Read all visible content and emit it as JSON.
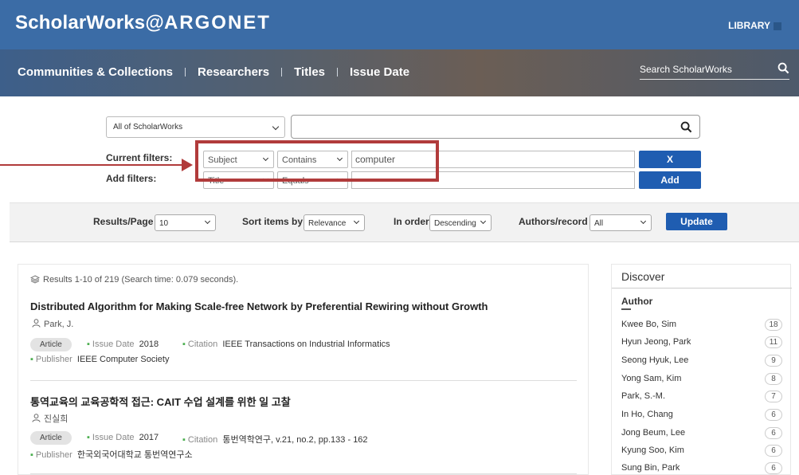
{
  "header": {
    "logo_main": "ScholarWorks@",
    "logo_argo": "ARGONET",
    "library_label": "LIBRARY",
    "nav": [
      "Communities & Collections",
      "Researchers",
      "Titles",
      "Issue Date"
    ],
    "search_placeholder": "Search ScholarWorks"
  },
  "search": {
    "scope_value": "All of ScholarWorks",
    "query_value": "",
    "current_filters_label": "Current filters:",
    "add_filters_label": "Add filters:",
    "current_filter": {
      "field": "Subject",
      "operator": "Contains",
      "value": "computer",
      "remove_label": "X"
    },
    "add_filter": {
      "field": "Title",
      "operator": "Equals",
      "value": "",
      "add_label": "Add"
    }
  },
  "options": {
    "results_per_page_label": "Results/Page",
    "results_per_page_value": "10",
    "sort_label": "Sort items by",
    "sort_value": "Relevance",
    "order_label": "In order",
    "order_value": "Descending",
    "authors_label": "Authors/record",
    "authors_value": "All",
    "update_label": "Update"
  },
  "results": {
    "info": "Results 1-10 of 219 (Search time: 0.079 seconds).",
    "items": [
      {
        "title": "Distributed Algorithm for Making Scale-free Network by Preferential Rewiring without Growth",
        "author": "Park, J.",
        "type": "Article",
        "issue_date_label": "Issue Date",
        "issue_date": "2018",
        "citation_label": "Citation",
        "citation": "IEEE Transactions on Industrial Informatics",
        "publisher_label": "Publisher",
        "publisher": "IEEE Computer Society"
      },
      {
        "title": "통역교육의 교육공학적 접근: CAIT 수업 설계를 위한 일 고찰",
        "author": "진실희",
        "type": "Article",
        "issue_date_label": "Issue Date",
        "issue_date": "2017",
        "citation_label": "Citation",
        "citation": "통번역학연구, v.21, no.2, pp.133 - 162",
        "publisher_label": "Publisher",
        "publisher": "한국외국어대학교 통번역연구소"
      }
    ]
  },
  "discover": {
    "title": "Discover",
    "facet_title": "Author",
    "authors": [
      {
        "name": "Kwee Bo, Sim",
        "count": "18"
      },
      {
        "name": "Hyun Jeong, Park",
        "count": "11"
      },
      {
        "name": "Seong Hyuk, Lee",
        "count": "9"
      },
      {
        "name": "Yong Sam, Kim",
        "count": "8"
      },
      {
        "name": "Park, S.-M.",
        "count": "7"
      },
      {
        "name": "In Ho, Chang",
        "count": "6"
      },
      {
        "name": "Jong Beum, Lee",
        "count": "6"
      },
      {
        "name": "Kyung Soo, Kim",
        "count": "6"
      },
      {
        "name": "Sung Bin, Park",
        "count": "6"
      }
    ]
  },
  "colors": {
    "accent_blue": "#1f5db1",
    "annotation_red": "#b13b3b"
  }
}
